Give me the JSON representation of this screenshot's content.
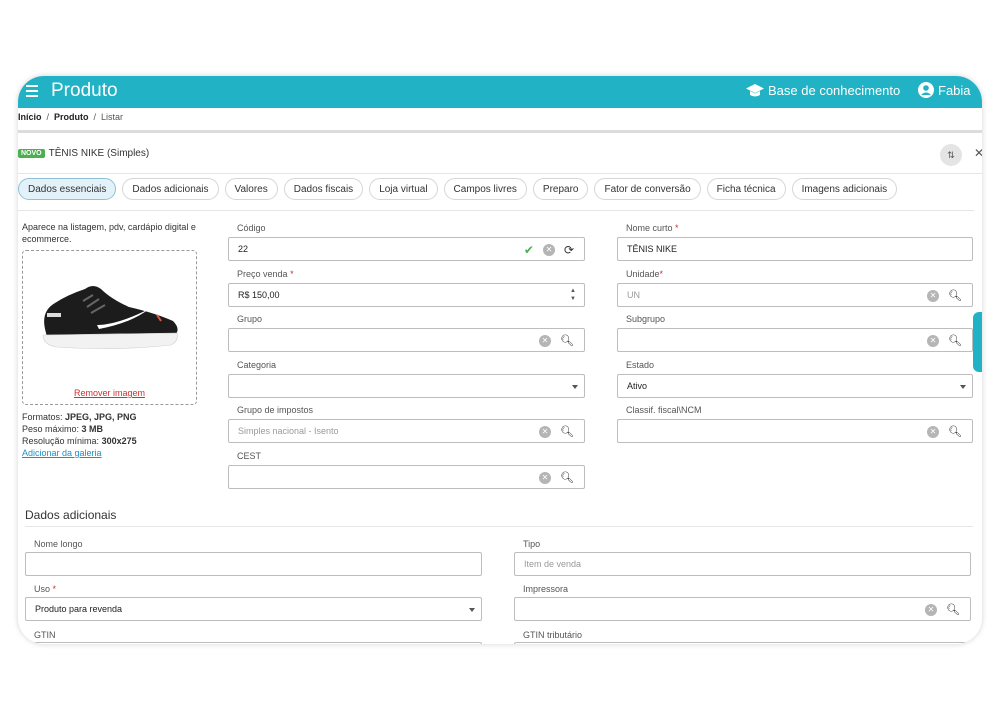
{
  "app": {
    "title": "Produto",
    "knowledge_base": "Base de conhecimento",
    "user": "Fabia",
    "accent": "#22b2c5"
  },
  "breadcrumb": {
    "home": "Início",
    "product": "Produto",
    "current": "Listar",
    "sep": "/"
  },
  "product": {
    "badge": "NOVO",
    "name": "TÊNIS NIKE (Simples)"
  },
  "tabs": [
    {
      "label": "Dados essenciais",
      "active": true
    },
    {
      "label": "Dados adicionais"
    },
    {
      "label": "Valores"
    },
    {
      "label": "Dados fiscais"
    },
    {
      "label": "Loja virtual"
    },
    {
      "label": "Campos livres"
    },
    {
      "label": "Preparo"
    },
    {
      "label": "Fator de conversão"
    },
    {
      "label": "Ficha técnica"
    },
    {
      "label": "Imagens adicionais"
    }
  ],
  "image": {
    "description": "Aparece na listagem, pdv, cardápio digital e ecommerce.",
    "remove": "Remover imagem",
    "formats_label": "Formatos:",
    "formats": "JPEG, JPG, PNG",
    "size_label": "Peso máximo:",
    "size": "3 MB",
    "resolution_label": "Resolução mínima:",
    "resolution": "300x275",
    "gallery": "Adicionar da galeria"
  },
  "fields": {
    "codigo": {
      "label": "Código",
      "value": "22"
    },
    "nome_curto": {
      "label": "Nome curto",
      "value": "TÊNIS NIKE"
    },
    "preco": {
      "label": "Preço venda",
      "value": "R$ 150,00"
    },
    "unidade": {
      "label": "Unidade",
      "placeholder": "UN"
    },
    "grupo": {
      "label": "Grupo",
      "value": ""
    },
    "subgrupo": {
      "label": "Subgrupo",
      "value": ""
    },
    "categoria": {
      "label": "Categoria",
      "value": ""
    },
    "estado": {
      "label": "Estado",
      "value": "Ativo"
    },
    "grupo_impostos": {
      "label": "Grupo de impostos",
      "placeholder": "Simples nacional - Isento"
    },
    "ncm": {
      "label": "Classif. fiscal\\NCM",
      "value": ""
    },
    "cest": {
      "label": "CEST",
      "value": ""
    }
  },
  "additional": {
    "title": "Dados adicionais",
    "nome_longo": {
      "label": "Nome longo",
      "value": ""
    },
    "tipo": {
      "label": "Tipo",
      "placeholder": "Item de venda"
    },
    "uso": {
      "label": "Uso",
      "value": "Produto para revenda"
    },
    "impressora": {
      "label": "Impressora",
      "value": ""
    },
    "gtin": {
      "label": "GTIN"
    },
    "gtin_trib": {
      "label": "GTIN tributário"
    }
  },
  "required_mark": "*",
  "icons": {
    "menu": "menu-icon",
    "kb": "graduation-cap-icon",
    "user": "user-circle-icon",
    "clear": "×"
  }
}
